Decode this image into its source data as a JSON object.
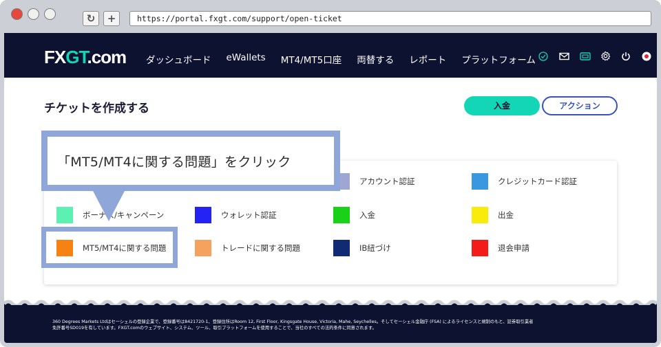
{
  "browser": {
    "url": "https://portal.fxgt.com/support/open-ticket",
    "reload_glyph": "↻",
    "new_tab_glyph": "+"
  },
  "site": {
    "logo_prefix": "FX",
    "logo_mid": "GT",
    "logo_suffix": ".com",
    "nav": [
      "ダッシュボード",
      "eWallets",
      "MT4/MT5口座",
      "両替する",
      "レポート",
      "プラットフォーム"
    ],
    "nav_icons": [
      "check-circle-icon",
      "mail-icon",
      "ticket-icon",
      "gear-icon",
      "power-icon",
      "language-flag-icon"
    ],
    "colors": {
      "navy": "#0c1230",
      "teal": "#12d6b5",
      "blue": "#3552c0",
      "callout": "#8fa6d8"
    }
  },
  "page": {
    "title": "チケットを作成する",
    "deposit_button": "入金",
    "action_button": "アクション"
  },
  "categories": [
    {
      "label": "アカウント認証",
      "color": "#9ea6d3"
    },
    {
      "label": "クレジットカード認証",
      "color": "#3a98e0"
    },
    {
      "label": "ボーナス/キャンペーン",
      "color": "#5cf0b3"
    },
    {
      "label": "ウォレット認証",
      "color": "#2323f5"
    },
    {
      "label": "入金",
      "color": "#19d119"
    },
    {
      "label": "出金",
      "color": "#f8ec0c"
    },
    {
      "label": "MT5/MT4に関する問題",
      "color": "#f58212"
    },
    {
      "label": "トレードに関する問題",
      "color": "#f5a25e"
    },
    {
      "label": "IB紐づけ",
      "color": "#102b74"
    },
    {
      "label": "退会申請",
      "color": "#f41b1b"
    }
  ],
  "callout": {
    "text": "「MT5/MT4に関する問題」をクリック"
  },
  "footer": {
    "line1": "360 Degrees Markets Ltdはセーシェルの登録企業で、登録番号は8421720-1、登録住所はRoom 12, First Floor, Kingsgate House, Victoria, Mahe, Seychelles。そしてセーシェル金融庁 (FSA) によるライセンスと規制のもと、証券取引業者",
    "line2": "免許番号SD019を有しています。FXGT.comのウェブサイト、システム、ツール、取引プラットフォームを使用することで、当社のすべての法的条件に同意されます。"
  }
}
